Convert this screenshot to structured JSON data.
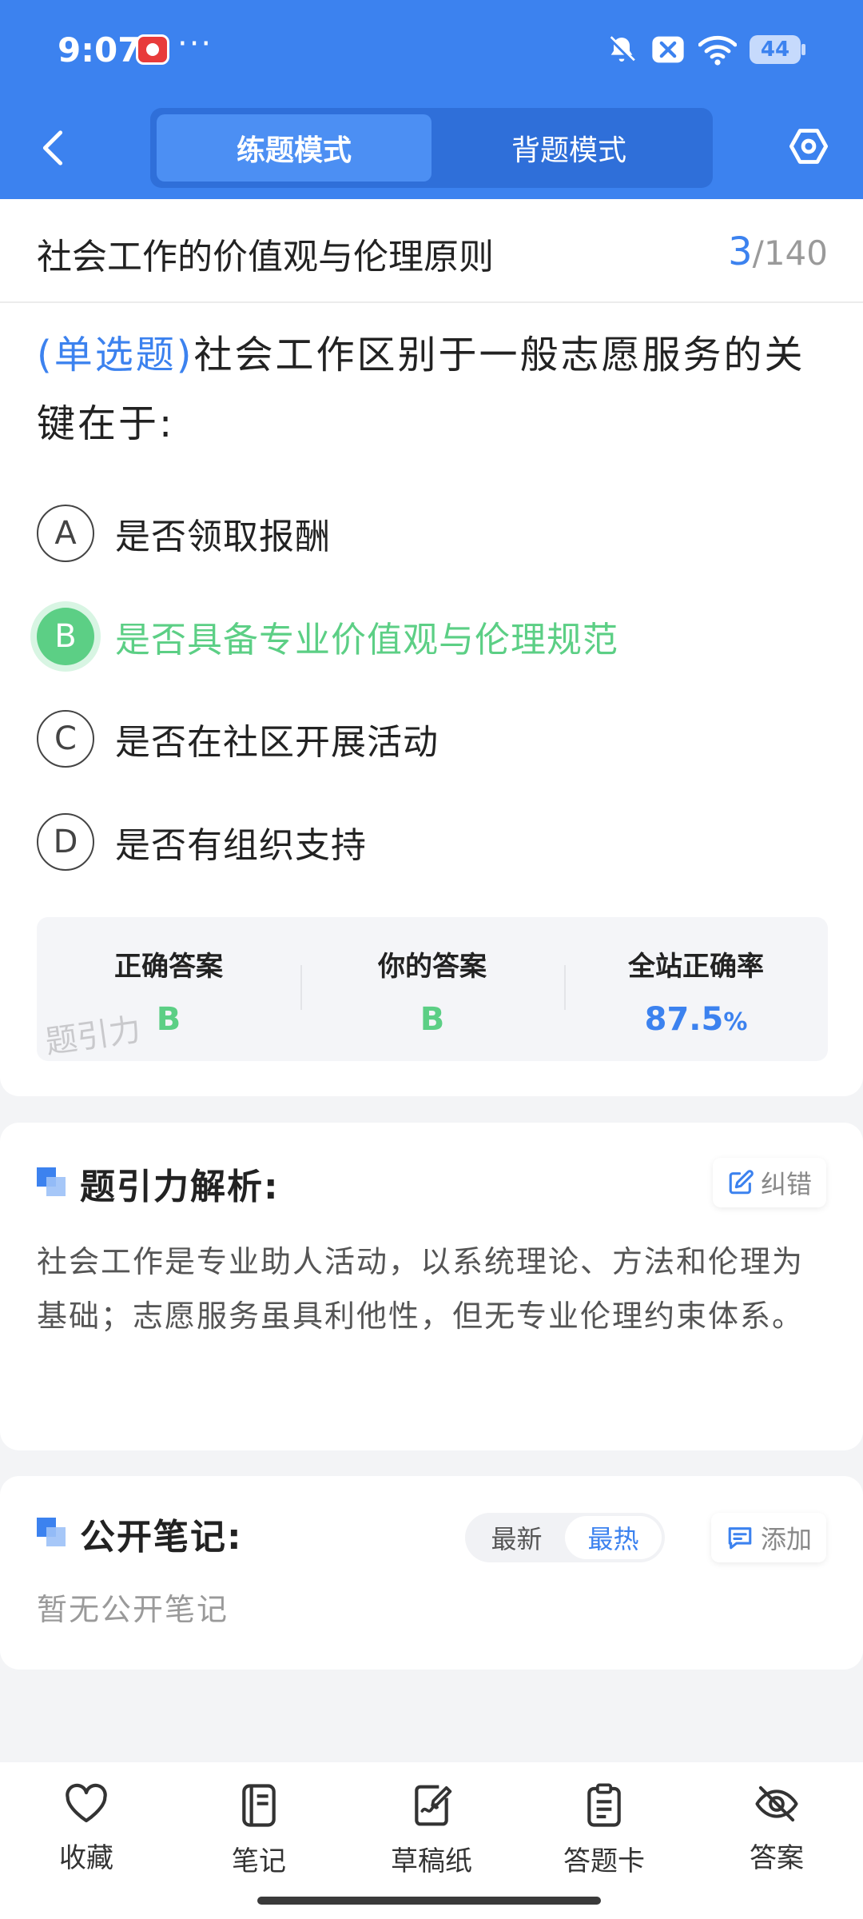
{
  "status_bar": {
    "time": "9:07",
    "more": "···",
    "battery": "44"
  },
  "nav": {
    "tabs": [
      {
        "label": "练题模式",
        "active": true
      },
      {
        "label": "背题模式",
        "active": false
      }
    ]
  },
  "header": {
    "chapter_title": "社会工作的价值观与伦理原则",
    "current": "3",
    "separator": "/",
    "total": "140"
  },
  "question": {
    "type": "(单选题)",
    "text": "社会工作区别于一般志愿服务的关键在于:"
  },
  "options": [
    {
      "letter": "A",
      "text": "是否领取报酬"
    },
    {
      "letter": "B",
      "text": "是否具备专业价值观与伦理规范"
    },
    {
      "letter": "C",
      "text": "是否在社区开展活动"
    },
    {
      "letter": "D",
      "text": "是否有组织支持"
    }
  ],
  "stats": {
    "correct_label": "正确答案",
    "correct_value": "B",
    "yours_label": "你的答案",
    "yours_value": "B",
    "rate_label": "全站正确率",
    "rate_value": "87.5",
    "rate_unit": "%",
    "watermark": "题引力"
  },
  "analysis": {
    "title": "题引力解析:",
    "correction_label": "纠错",
    "text": "社会工作是专业助人活动，以系统理论、方法和伦理为基础；志愿服务虽具利他性，但无专业伦理约束体系。"
  },
  "notes": {
    "title": "公开笔记:",
    "sort_options": [
      "最新",
      "最热"
    ],
    "sort_active": "最热",
    "add_label": "添加",
    "empty_text": "暂无公开笔记"
  },
  "bottom_bar": [
    {
      "label": "收藏",
      "icon": "heart-icon"
    },
    {
      "label": "笔记",
      "icon": "notebook-icon"
    },
    {
      "label": "草稿纸",
      "icon": "draft-icon"
    },
    {
      "label": "答题卡",
      "icon": "answer-card-icon"
    },
    {
      "label": "答案",
      "icon": "eye-off-icon"
    }
  ],
  "colors": {
    "primary": "#3c82ef",
    "correct": "#5ccf85"
  }
}
